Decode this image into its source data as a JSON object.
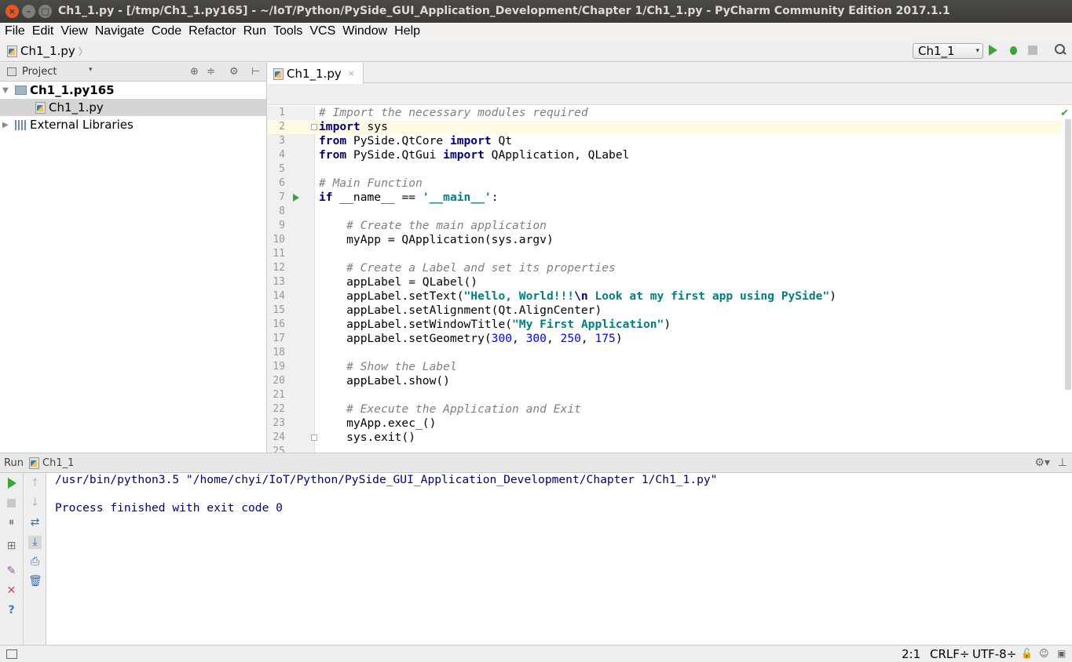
{
  "window": {
    "title": "Ch1_1.py - [/tmp/Ch1_1.py165] - ~/IoT/Python/PySide_GUI_Application_Development/Chapter 1/Ch1_1.py - PyCharm Community Edition 2017.1.1",
    "close": "×",
    "minimize": "–",
    "maximize": "□"
  },
  "menu": [
    "File",
    "Edit",
    "View",
    "Navigate",
    "Code",
    "Refactor",
    "Run",
    "Tools",
    "VCS",
    "Window",
    "Help"
  ],
  "navbar": {
    "file": "Ch1_1.py",
    "chevron": "〉",
    "run_config": "Ch1_1",
    "run_config_arrow": "▾"
  },
  "project": {
    "header": "Project",
    "dropdown": "▾",
    "header_icons": [
      "⊕",
      "≑",
      "⚙",
      "⊢"
    ],
    "tree": {
      "root": "Ch1_1.py165",
      "file": "Ch1_1.py",
      "libs": "External Libraries"
    }
  },
  "editor": {
    "tab": "Ch1_1.py",
    "tab_close": "×",
    "check": "✔",
    "lines": [
      {
        "n": "1",
        "parts": [
          [
            "cm",
            "# Import the necessary modules required"
          ]
        ]
      },
      {
        "n": "2",
        "parts": [
          [
            "kw",
            "import"
          ],
          [
            "",
            " sys"
          ]
        ]
      },
      {
        "n": "3",
        "parts": [
          [
            "kw",
            "from"
          ],
          [
            "",
            " PySide.QtCore "
          ],
          [
            "kw",
            "import"
          ],
          [
            "",
            " Qt"
          ]
        ]
      },
      {
        "n": "4",
        "parts": [
          [
            "kw",
            "from"
          ],
          [
            "",
            " PySide.QtGui "
          ],
          [
            "kw",
            "import"
          ],
          [
            "",
            " QApplication, QLabel"
          ]
        ]
      },
      {
        "n": "5",
        "parts": []
      },
      {
        "n": "6",
        "parts": [
          [
            "cm",
            "# Main Function"
          ]
        ]
      },
      {
        "n": "7",
        "parts": [
          [
            "kw",
            "if"
          ],
          [
            "",
            " __name__ == "
          ],
          [
            "st",
            "'__main__'"
          ],
          [
            "",
            ":"
          ]
        ]
      },
      {
        "n": "8",
        "parts": []
      },
      {
        "n": "9",
        "parts": [
          [
            "",
            "    "
          ],
          [
            "cm",
            "# Create the main application"
          ]
        ]
      },
      {
        "n": "10",
        "parts": [
          [
            "",
            "    myApp = QApplication(sys.argv)"
          ]
        ]
      },
      {
        "n": "11",
        "parts": []
      },
      {
        "n": "12",
        "parts": [
          [
            "",
            "    "
          ],
          [
            "cm",
            "# Create a Label and set its properties"
          ]
        ]
      },
      {
        "n": "13",
        "parts": [
          [
            "",
            "    appLabel = QLabel()"
          ]
        ]
      },
      {
        "n": "14",
        "parts": [
          [
            "",
            "    appLabel.setText("
          ],
          [
            "st",
            "\"Hello, World!!!"
          ],
          [
            "kw",
            "\\n"
          ],
          [
            "st",
            " Look at my first app using PySide\""
          ],
          [
            "",
            ")"
          ]
        ]
      },
      {
        "n": "15",
        "parts": [
          [
            "",
            "    appLabel.setAlignment(Qt.AlignCenter)"
          ]
        ]
      },
      {
        "n": "16",
        "parts": [
          [
            "",
            "    appLabel.setWindowTitle("
          ],
          [
            "st",
            "\"My First Application\""
          ],
          [
            "",
            ")"
          ]
        ]
      },
      {
        "n": "17",
        "parts": [
          [
            "",
            "    appLabel.setGeometry("
          ],
          [
            "nm",
            "300"
          ],
          [
            "",
            ", "
          ],
          [
            "nm",
            "300"
          ],
          [
            "",
            ", "
          ],
          [
            "nm",
            "250"
          ],
          [
            "",
            ", "
          ],
          [
            "nm",
            "175"
          ],
          [
            "",
            ")"
          ]
        ]
      },
      {
        "n": "18",
        "parts": []
      },
      {
        "n": "19",
        "parts": [
          [
            "",
            "    "
          ],
          [
            "cm",
            "# Show the Label"
          ]
        ]
      },
      {
        "n": "20",
        "parts": [
          [
            "",
            "    appLabel.show()"
          ]
        ]
      },
      {
        "n": "21",
        "parts": []
      },
      {
        "n": "22",
        "parts": [
          [
            "",
            "    "
          ],
          [
            "cm",
            "# Execute the Application and Exit"
          ]
        ]
      },
      {
        "n": "23",
        "parts": [
          [
            "",
            "    myApp.exec_()"
          ]
        ]
      },
      {
        "n": "24",
        "parts": [
          [
            "",
            "    sys.exit()"
          ]
        ]
      },
      {
        "n": "25",
        "parts": []
      }
    ]
  },
  "run": {
    "title": "Run",
    "config": "Ch1_1",
    "gear": "⚙▾",
    "minimize": "⊥",
    "tools_left": [
      "",
      "",
      "⏸",
      "⊞",
      "✎",
      "✕",
      "?"
    ],
    "tools_right": [
      "↑",
      "↓",
      "⇄",
      "⤓",
      "⎙",
      "🗑"
    ],
    "console": [
      "/usr/bin/python3.5 \"/home/chyi/IoT/Python/PySide_GUI_Application_Development/Chapter 1/Ch1_1.py\"",
      "",
      "Process finished with exit code 0"
    ]
  },
  "status": {
    "position": "2:1",
    "line_sep": "CRLF÷",
    "encoding": "UTF-8÷",
    "icons": [
      "🔓",
      "☺",
      "▣"
    ]
  }
}
